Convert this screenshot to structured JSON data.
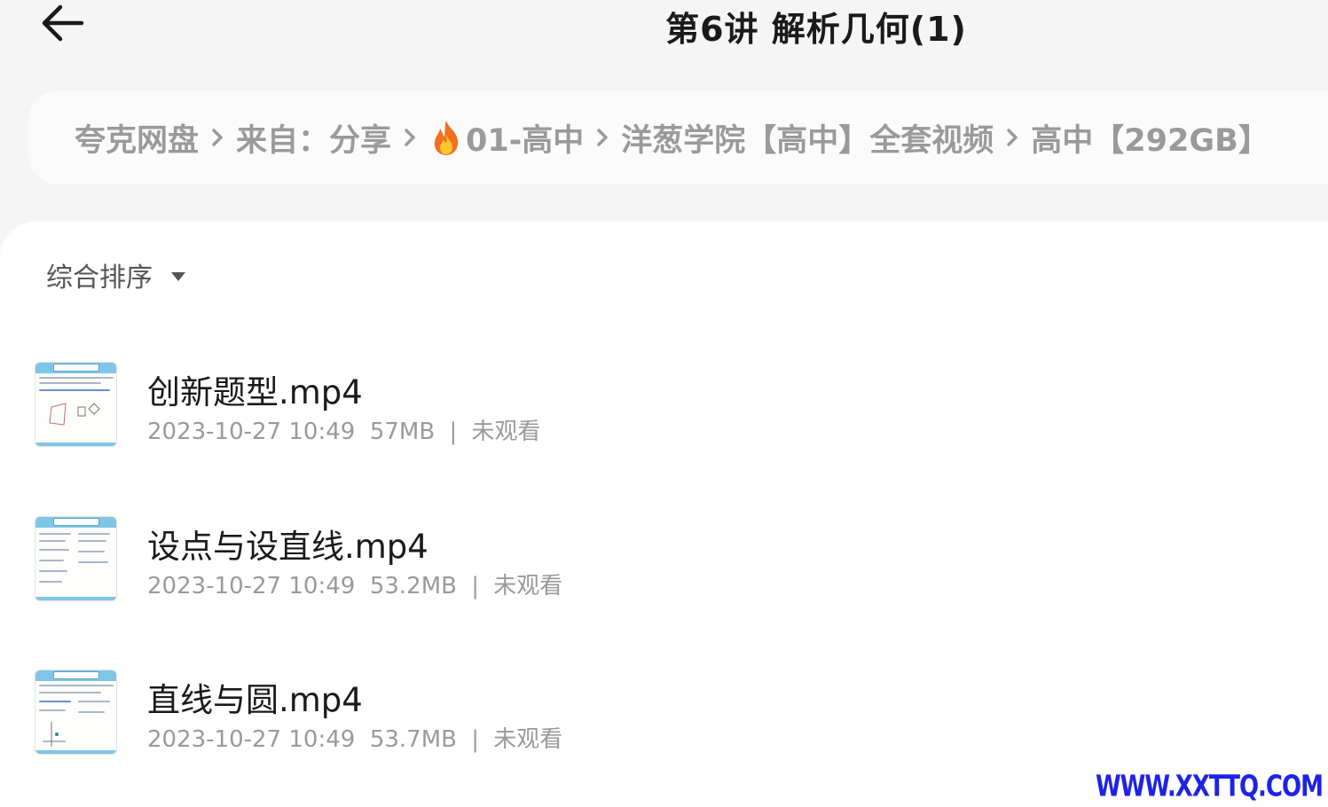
{
  "header": {
    "title": "第6讲 解析几何(1)",
    "back_icon": "arrow-left-icon"
  },
  "breadcrumb": {
    "items": [
      {
        "label": "夸克网盘"
      },
      {
        "label": "来自：分享"
      },
      {
        "label": "01-高中",
        "icon": "fire-icon"
      },
      {
        "label": "洋葱学院【高中】全套视频"
      },
      {
        "label": "高中【292GB】"
      }
    ]
  },
  "sort": {
    "label": "综合排序",
    "icon": "caret-down-icon"
  },
  "files": [
    {
      "name": "创新题型.mp4",
      "date": "2023-10-27 10:49",
      "size": "57MB",
      "status": "未观看"
    },
    {
      "name": "设点与设直线.mp4",
      "date": "2023-10-27 10:49",
      "size": "53.2MB",
      "status": "未观看"
    },
    {
      "name": "直线与圆.mp4",
      "date": "2023-10-27 10:49",
      "size": "53.7MB",
      "status": "未观看"
    }
  ],
  "meta_separator": "|",
  "watermark": "WWW.XXTTQ.COM",
  "colors": {
    "background": "#f5f5f5",
    "card": "#ffffff",
    "muted_text": "#9a9a9a",
    "thumb_accent": "#7fc6e6",
    "watermark": "#1d23e6"
  }
}
